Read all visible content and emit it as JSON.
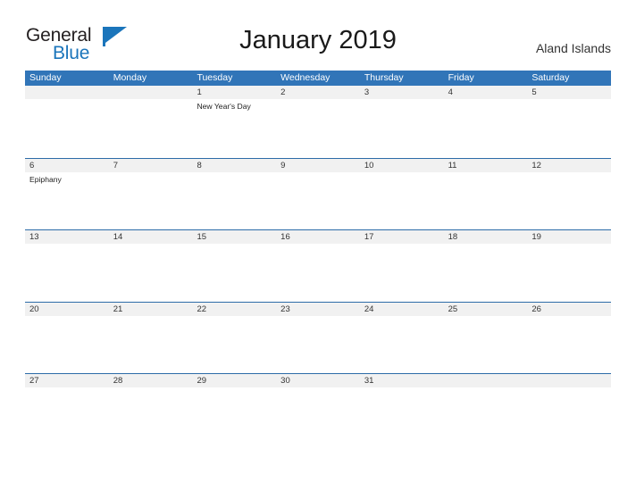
{
  "brand": {
    "name_part1": "General",
    "name_part2": "Blue",
    "mark_icon": "blue-flag-triangle-icon",
    "color_dark": "#231f20",
    "color_blue": "#1b75bb"
  },
  "header": {
    "title": "January 2019",
    "locale": "Aland Islands"
  },
  "colors": {
    "header_blue": "#3175b8",
    "week_rule_blue": "#2d6ca8",
    "date_band_gray": "#f1f1f1",
    "text_dark": "#333333"
  },
  "calendar": {
    "month": "January",
    "year": "2019",
    "weekday_headers": [
      "Sunday",
      "Monday",
      "Tuesday",
      "Wednesday",
      "Thursday",
      "Friday",
      "Saturday"
    ],
    "weeks": [
      {
        "days": [
          {
            "date": "",
            "events": []
          },
          {
            "date": "",
            "events": []
          },
          {
            "date": "1",
            "events": [
              "New Year's Day"
            ]
          },
          {
            "date": "2",
            "events": []
          },
          {
            "date": "3",
            "events": []
          },
          {
            "date": "4",
            "events": []
          },
          {
            "date": "5",
            "events": []
          }
        ]
      },
      {
        "days": [
          {
            "date": "6",
            "events": [
              "Epiphany"
            ]
          },
          {
            "date": "7",
            "events": []
          },
          {
            "date": "8",
            "events": []
          },
          {
            "date": "9",
            "events": []
          },
          {
            "date": "10",
            "events": []
          },
          {
            "date": "11",
            "events": []
          },
          {
            "date": "12",
            "events": []
          }
        ]
      },
      {
        "days": [
          {
            "date": "13",
            "events": []
          },
          {
            "date": "14",
            "events": []
          },
          {
            "date": "15",
            "events": []
          },
          {
            "date": "16",
            "events": []
          },
          {
            "date": "17",
            "events": []
          },
          {
            "date": "18",
            "events": []
          },
          {
            "date": "19",
            "events": []
          }
        ]
      },
      {
        "days": [
          {
            "date": "20",
            "events": []
          },
          {
            "date": "21",
            "events": []
          },
          {
            "date": "22",
            "events": []
          },
          {
            "date": "23",
            "events": []
          },
          {
            "date": "24",
            "events": []
          },
          {
            "date": "25",
            "events": []
          },
          {
            "date": "26",
            "events": []
          }
        ]
      },
      {
        "days": [
          {
            "date": "27",
            "events": []
          },
          {
            "date": "28",
            "events": []
          },
          {
            "date": "29",
            "events": []
          },
          {
            "date": "30",
            "events": []
          },
          {
            "date": "31",
            "events": []
          },
          {
            "date": "",
            "events": []
          },
          {
            "date": "",
            "events": []
          }
        ]
      }
    ]
  }
}
